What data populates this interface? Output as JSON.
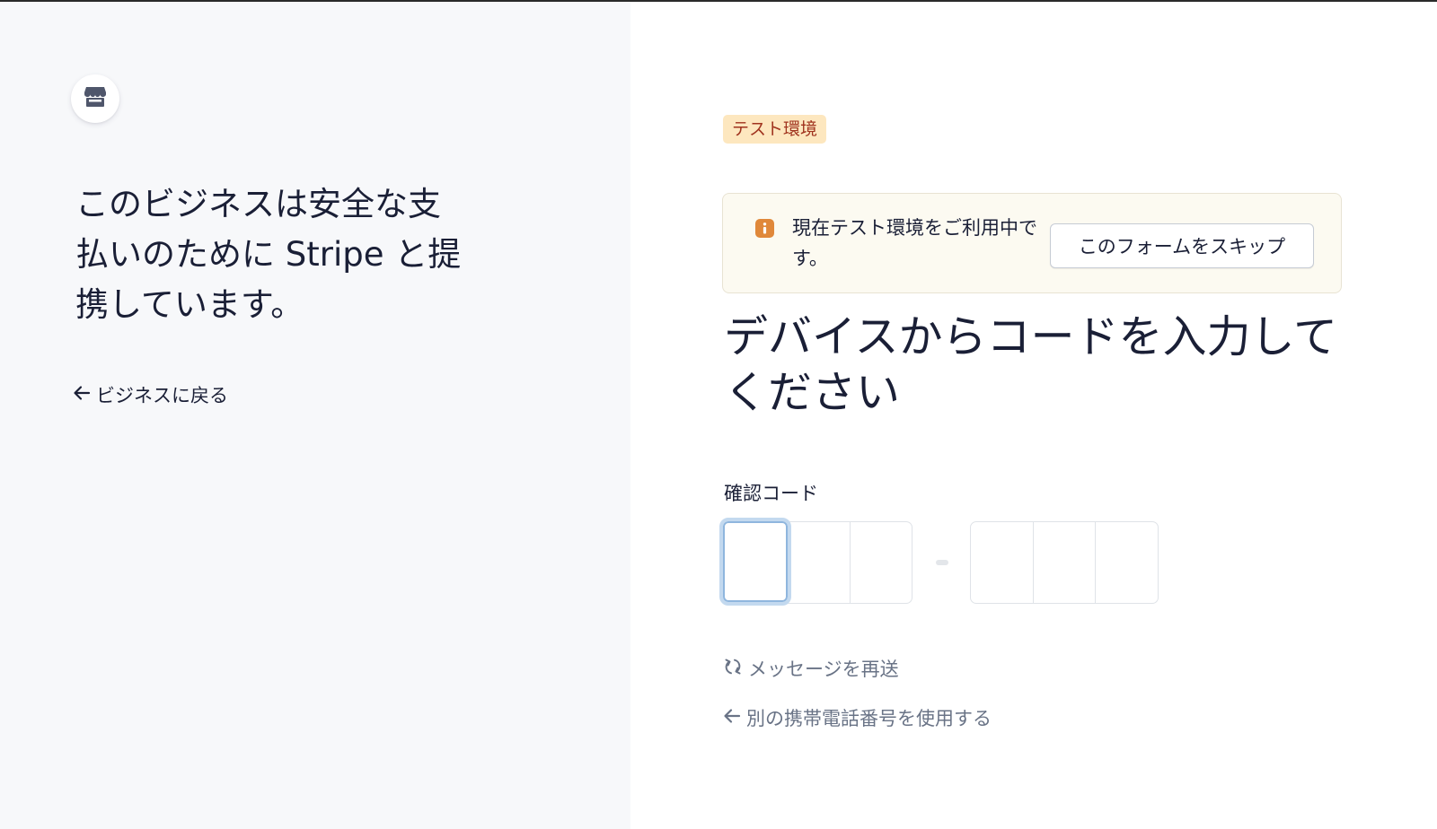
{
  "business": {
    "icon": "store-icon",
    "headline": "このビジネスは安全な支払いのために Stripe と提携しています。",
    "back_label": "ビジネスに戻る"
  },
  "environment_badge": "テスト環境",
  "notice": {
    "icon": "info-icon",
    "text": "現在テスト環境をご利用中です。",
    "skip_label": "このフォームをスキップ"
  },
  "form": {
    "heading": "デバイスからコードを入力してください",
    "code_label": "確認コード",
    "code_digits": [
      "",
      "",
      "",
      "",
      "",
      ""
    ],
    "resend_label": "メッセージを再送",
    "alt_phone_label": "別の携帯電話番号を使用する"
  },
  "colors": {
    "env_badge_bg": "#fde7bf",
    "env_badge_text": "#a0331e",
    "notice_bg": "#fcfaf1",
    "info_icon": "#e0883a",
    "focus_ring": "#c3d9ef",
    "muted_link": "#697386"
  }
}
